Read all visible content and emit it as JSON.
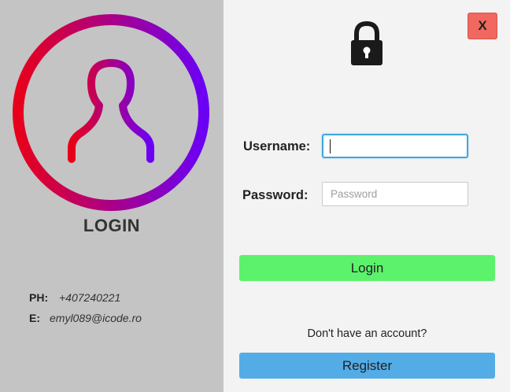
{
  "window": {
    "close_label": "X"
  },
  "left_panel": {
    "title": "LOGIN",
    "contact": [
      {
        "key": "PH:",
        "value": "+407240221"
      },
      {
        "key": "E:",
        "value": "emyl089@icode.ro"
      }
    ]
  },
  "form": {
    "username_label": "Username:",
    "username_value": "",
    "password_label": "Password:",
    "password_placeholder": "Password",
    "login_button": "Login",
    "no_account_text": "Don't have an account?",
    "register_button": "Register"
  },
  "colors": {
    "left_panel_bg": "#c4c4c4",
    "right_panel_bg": "#f3f3f3",
    "logo_gradient_start": "#e8001a",
    "logo_gradient_end": "#6b00f5",
    "login_button_bg": "#5cf26b",
    "register_button_bg": "#54ace7",
    "close_button_bg": "#f0685f",
    "focus_border": "#3fa7dc"
  },
  "icons": [
    "user-avatar-icon",
    "lock-icon"
  ]
}
